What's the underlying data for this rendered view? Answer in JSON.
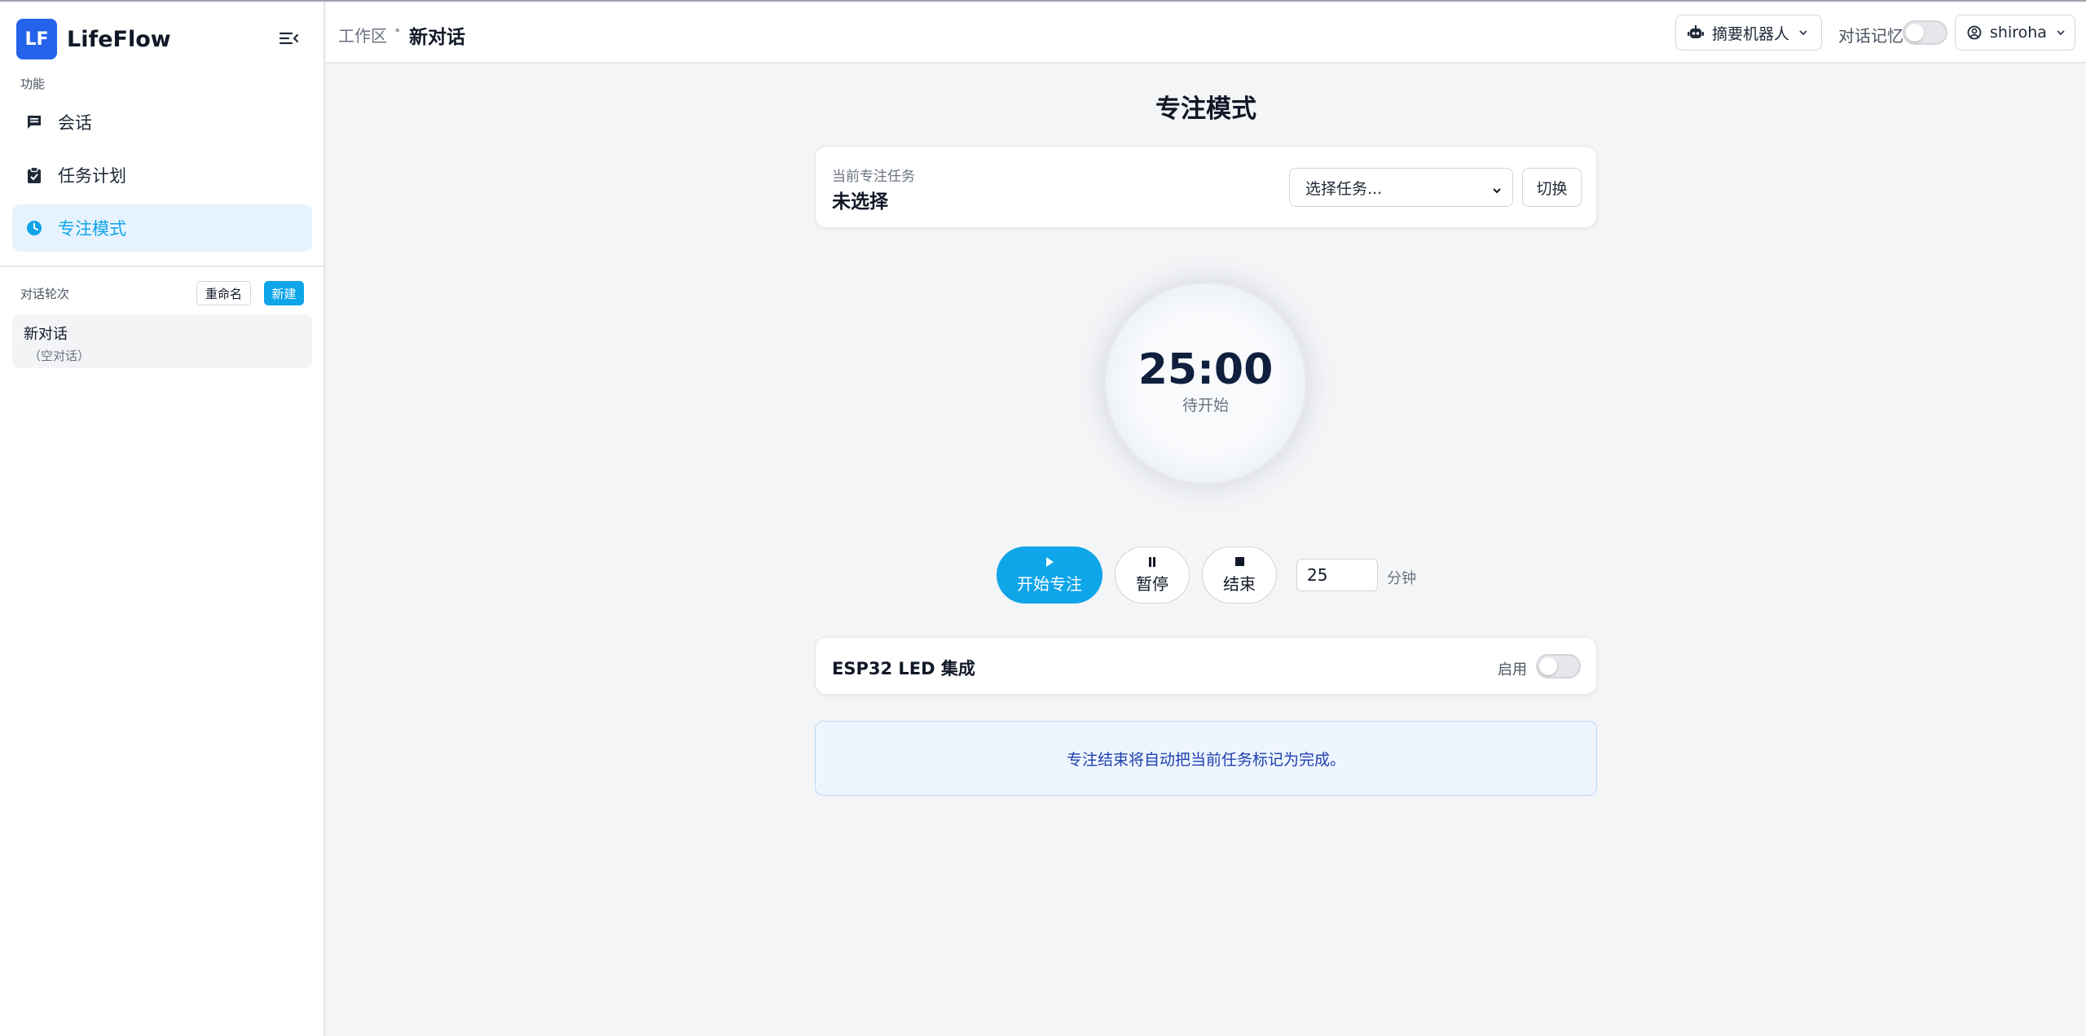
{
  "app": {
    "logo": "LF",
    "name": "LifeFlow"
  },
  "sidebar": {
    "section_functions": "功能",
    "nav": [
      {
        "label": "会话",
        "icon": "chat-icon",
        "active": false
      },
      {
        "label": "任务计划",
        "icon": "clipboard-icon",
        "active": false
      },
      {
        "label": "专注模式",
        "icon": "clock-icon",
        "active": true
      }
    ],
    "section_conversations": "对话轮次",
    "rename_label": "重命名",
    "new_label": "新建",
    "conversations": [
      {
        "title": "新对话",
        "subtitle": "（空对话）"
      }
    ]
  },
  "header": {
    "breadcrumb_root": "工作区",
    "breadcrumb_sep": "•",
    "breadcrumb_current": "新对话",
    "bot_label": "摘要机器人",
    "memory_label": "对话记忆",
    "memory_enabled": false,
    "user_name": "shiroha"
  },
  "focus": {
    "title": "专注模式",
    "current_task_label": "当前专注任务",
    "current_task_value": "未选择",
    "task_select_placeholder": "选择任务...",
    "switch_label": "切换",
    "timer_value": "25:00",
    "timer_status": "待开始",
    "start_label": "开始专注",
    "pause_label": "暂停",
    "end_label": "结束",
    "minutes_value": "25",
    "minutes_unit": "分钟",
    "esp_title": "ESP32 LED 集成",
    "esp_enable_label": "启用",
    "esp_enabled": false,
    "info_text": "专注结束将自动把当前任务标记为完成。"
  },
  "colors": {
    "accent": "#0ea5e9",
    "logo_bg": "#2563eb",
    "active_nav_bg": "#e6f2fd",
    "info_bg": "#eef5fe"
  }
}
